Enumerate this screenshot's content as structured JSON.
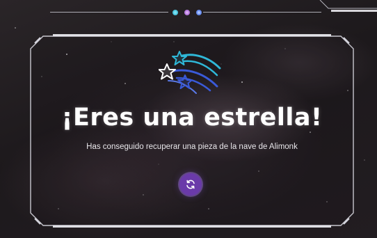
{
  "header": {
    "progress_dots": [
      {
        "name": "dot-1",
        "color": "#4fc7e0"
      },
      {
        "name": "dot-2",
        "color": "#b77be0"
      },
      {
        "name": "dot-3",
        "color": "#6a8ef0"
      }
    ]
  },
  "result": {
    "emblem_icon": "shooting-stars-icon",
    "title": "¡Eres una estrella!",
    "message": "Has conseguido recuperar una pieza de la nave de Alimonk",
    "retry_icon": "refresh-icon"
  },
  "colors": {
    "button": "#6a3aa9",
    "star_cyan": "#2fb8d8",
    "star_blue": "#3a5ad8",
    "star_white": "#ffffff"
  }
}
